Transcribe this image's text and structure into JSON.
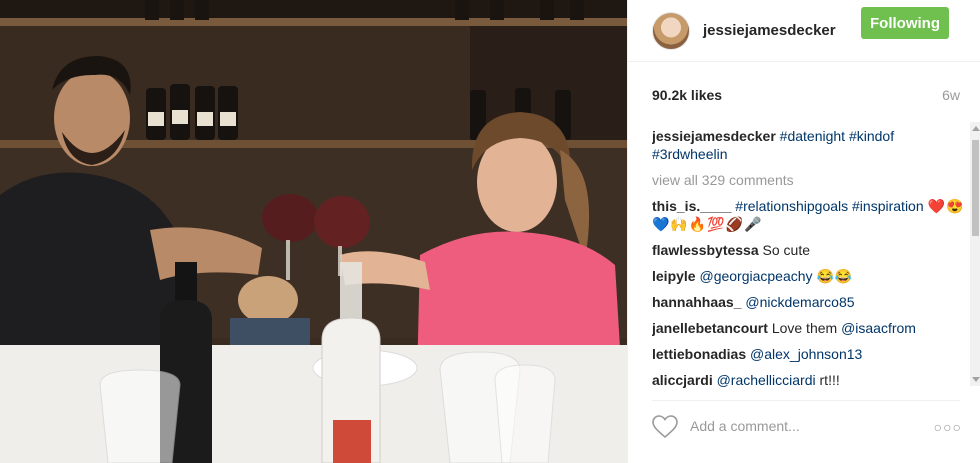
{
  "photo": {
    "description_icon": "photo-icon"
  },
  "post": {
    "username": "jessiejamesdecker",
    "follow_label": "Following",
    "likes": "90.2k likes",
    "age": "6w",
    "caption_user": "jessiejamesdecker",
    "caption_text": "#datenight #kindof #3rdwheelin",
    "view_all": "view all 329 comments"
  },
  "comments": [
    {
      "user": "this_is.____",
      "text": "#relationshipgoals #inspiration",
      "emoji": "❤️😍💙🙌🔥💯🏈🎤",
      "text_is_tag": true
    },
    {
      "user": "flawlessbytessa",
      "text": "So cute",
      "emoji": "",
      "text_is_tag": false
    },
    {
      "user": "leipyle",
      "text": "@georgiacpeachy",
      "emoji": "😂😂",
      "text_is_tag": true
    },
    {
      "user": "hannahhaas_",
      "text": "@nickdemarco85",
      "emoji": "",
      "text_is_tag": true
    },
    {
      "user": "janellebetancourt",
      "text": "Love them",
      "mention": "@isaacfrom",
      "emoji": "",
      "text_is_tag": false
    },
    {
      "user": "lettiebonadias",
      "text": "@alex_johnson13",
      "emoji": "",
      "text_is_tag": true
    },
    {
      "user": "aliccjardi",
      "text": "@rachellicciardi",
      "tail": "rt!!!",
      "emoji": "",
      "text_is_tag": true
    }
  ],
  "footer": {
    "placeholder": "Add a comment...",
    "more_label": "○○○",
    "heart_icon": "heart-icon"
  }
}
